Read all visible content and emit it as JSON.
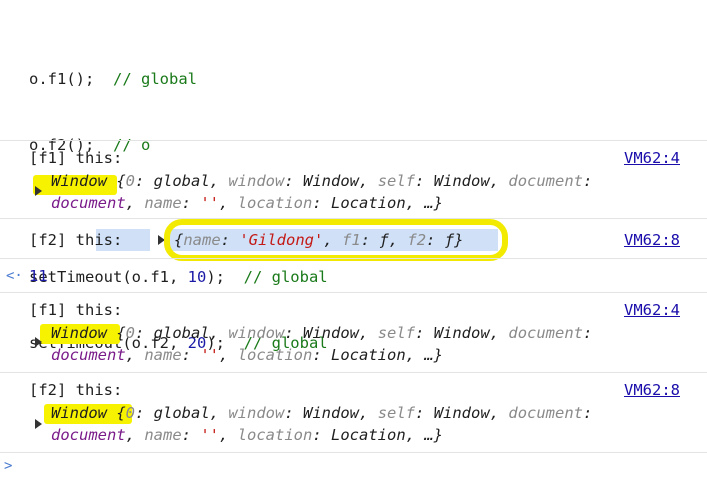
{
  "code": {
    "line1": {
      "code": "o.f1();  ",
      "comment": "// global"
    },
    "line2": {
      "code": "o.f2();  ",
      "comment": "// o"
    },
    "line3": {
      "pre": "setTimeout(o.f1, ",
      "num": "10",
      "post": ");  ",
      "comment": "// global"
    },
    "line4": {
      "pre": "setTimeout(o.f2, ",
      "num": "20",
      "post": ");  ",
      "comment": "// global"
    }
  },
  "logs": [
    {
      "label": "[f1] this:",
      "source": "VM62:4",
      "obj_head": "Window {",
      "k0": "0",
      "v0": "global",
      "k1": "window",
      "v1": "Window",
      "k2": "self",
      "v2": "Window",
      "k3": "document",
      "v3": "document",
      "k4": "name",
      "v4": "''",
      "k5": "location",
      "v5": "Location",
      "tail": "…}"
    },
    {
      "label": "[f2] this:",
      "source": "VM62:8",
      "obj_open": "{",
      "k_name": "name",
      "v_name": "'Gildong'",
      "k_f1": "f1",
      "v_f1": "ƒ",
      "k_f2": "f2",
      "v_f2": "ƒ",
      "obj_close": "}"
    },
    {
      "label": "[f1] this:",
      "source": "VM62:4",
      "obj_head": "Window {",
      "k0": "0",
      "v0": "global",
      "k1": "window",
      "v1": "Window",
      "k2": "self",
      "v2": "Window",
      "k3": "document",
      "v3": "document",
      "k4": "name",
      "v4": "''",
      "k5": "location",
      "v5": "Location",
      "tail": "…}"
    },
    {
      "label": "[f2] this:",
      "source": "VM62:8",
      "obj_head": "Window {",
      "k0": "0",
      "v0": "global",
      "k1": "window",
      "v1": "Window",
      "k2": "self",
      "v2": "Window",
      "k3": "document",
      "v3": "document",
      "k4": "name",
      "v4": "''",
      "k5": "location",
      "v5": "Location",
      "tail": "…}"
    }
  ],
  "return_value": {
    "prompt": "<·",
    "value": "11"
  },
  "input_prompt": ">",
  "colors": {
    "highlight": "#f7f200",
    "link": "#1a0dab",
    "comment": "#1a7a1a",
    "number": "#1a1aa6",
    "string": "#c41a16",
    "key": "#8a8a8a"
  }
}
